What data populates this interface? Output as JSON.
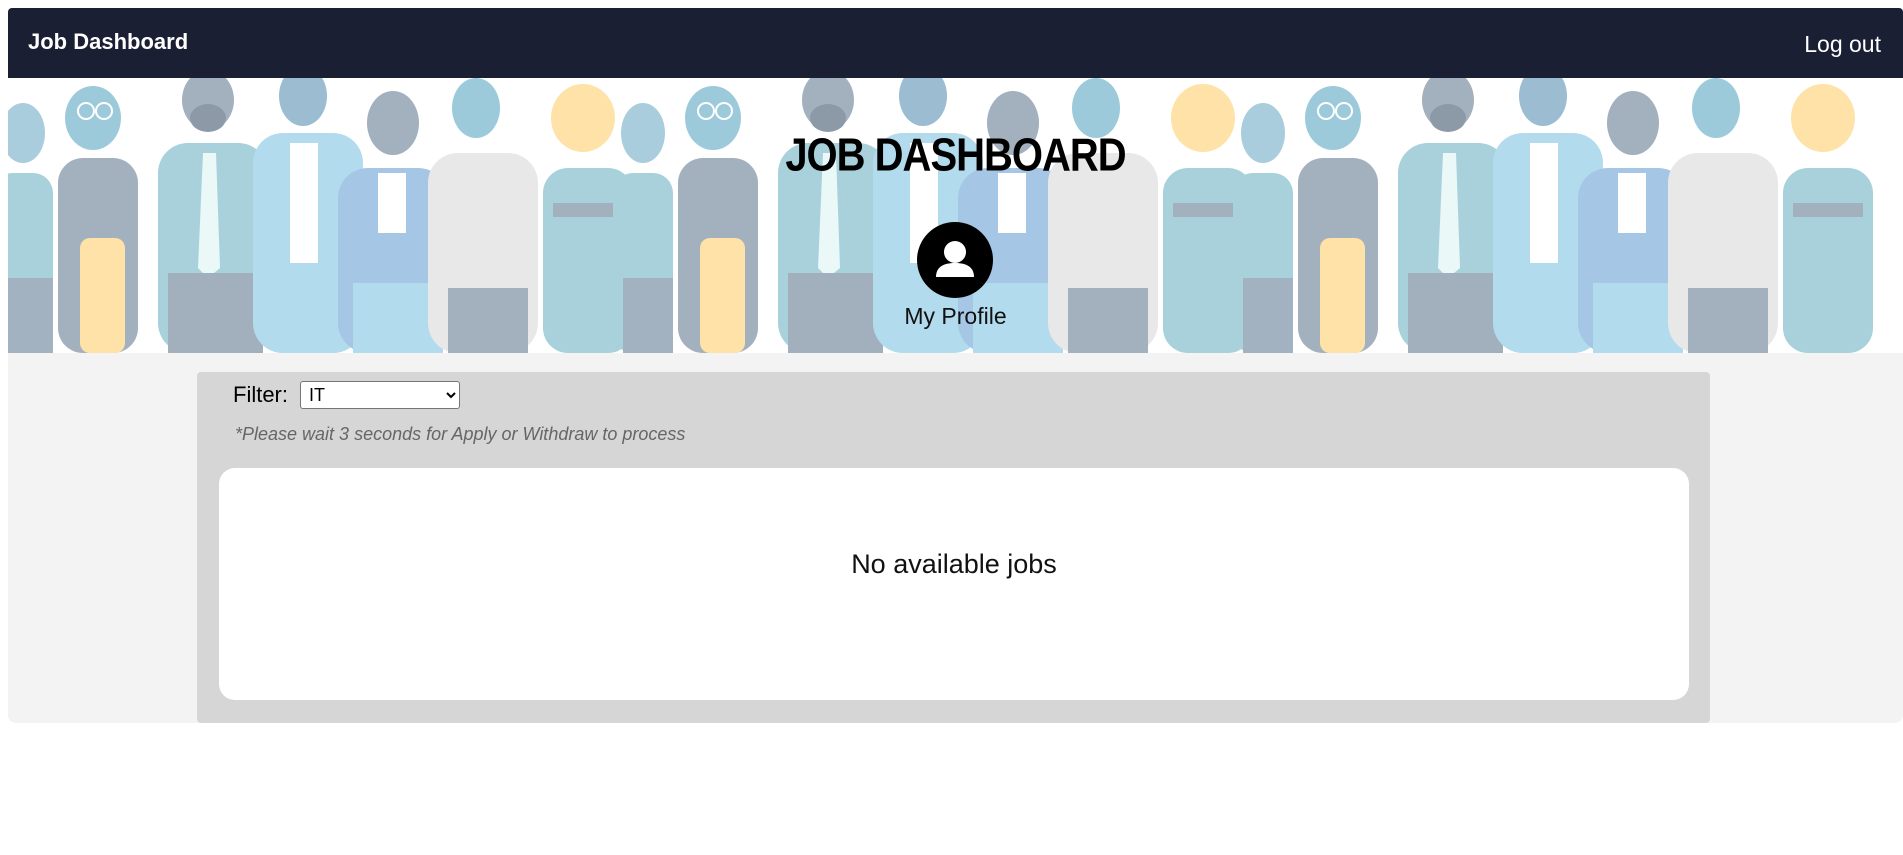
{
  "navbar": {
    "brand": "Job Dashboard",
    "logout_label": "Log out",
    "background_color": "#1a1f33"
  },
  "hero": {
    "title": "JOB DASHBOARD",
    "profile_icon": "user-avatar-icon",
    "profile_label": "My Profile"
  },
  "filter": {
    "label": "Filter:",
    "selected": "IT",
    "options": [
      "IT"
    ]
  },
  "note": "*Please wait 3 seconds for Apply or Withdraw to process",
  "jobs": {
    "empty_message": "No available jobs"
  },
  "colors": {
    "panel": "#d6d6d6",
    "main_background": "#f3f3f3",
    "card": "#ffffff"
  }
}
